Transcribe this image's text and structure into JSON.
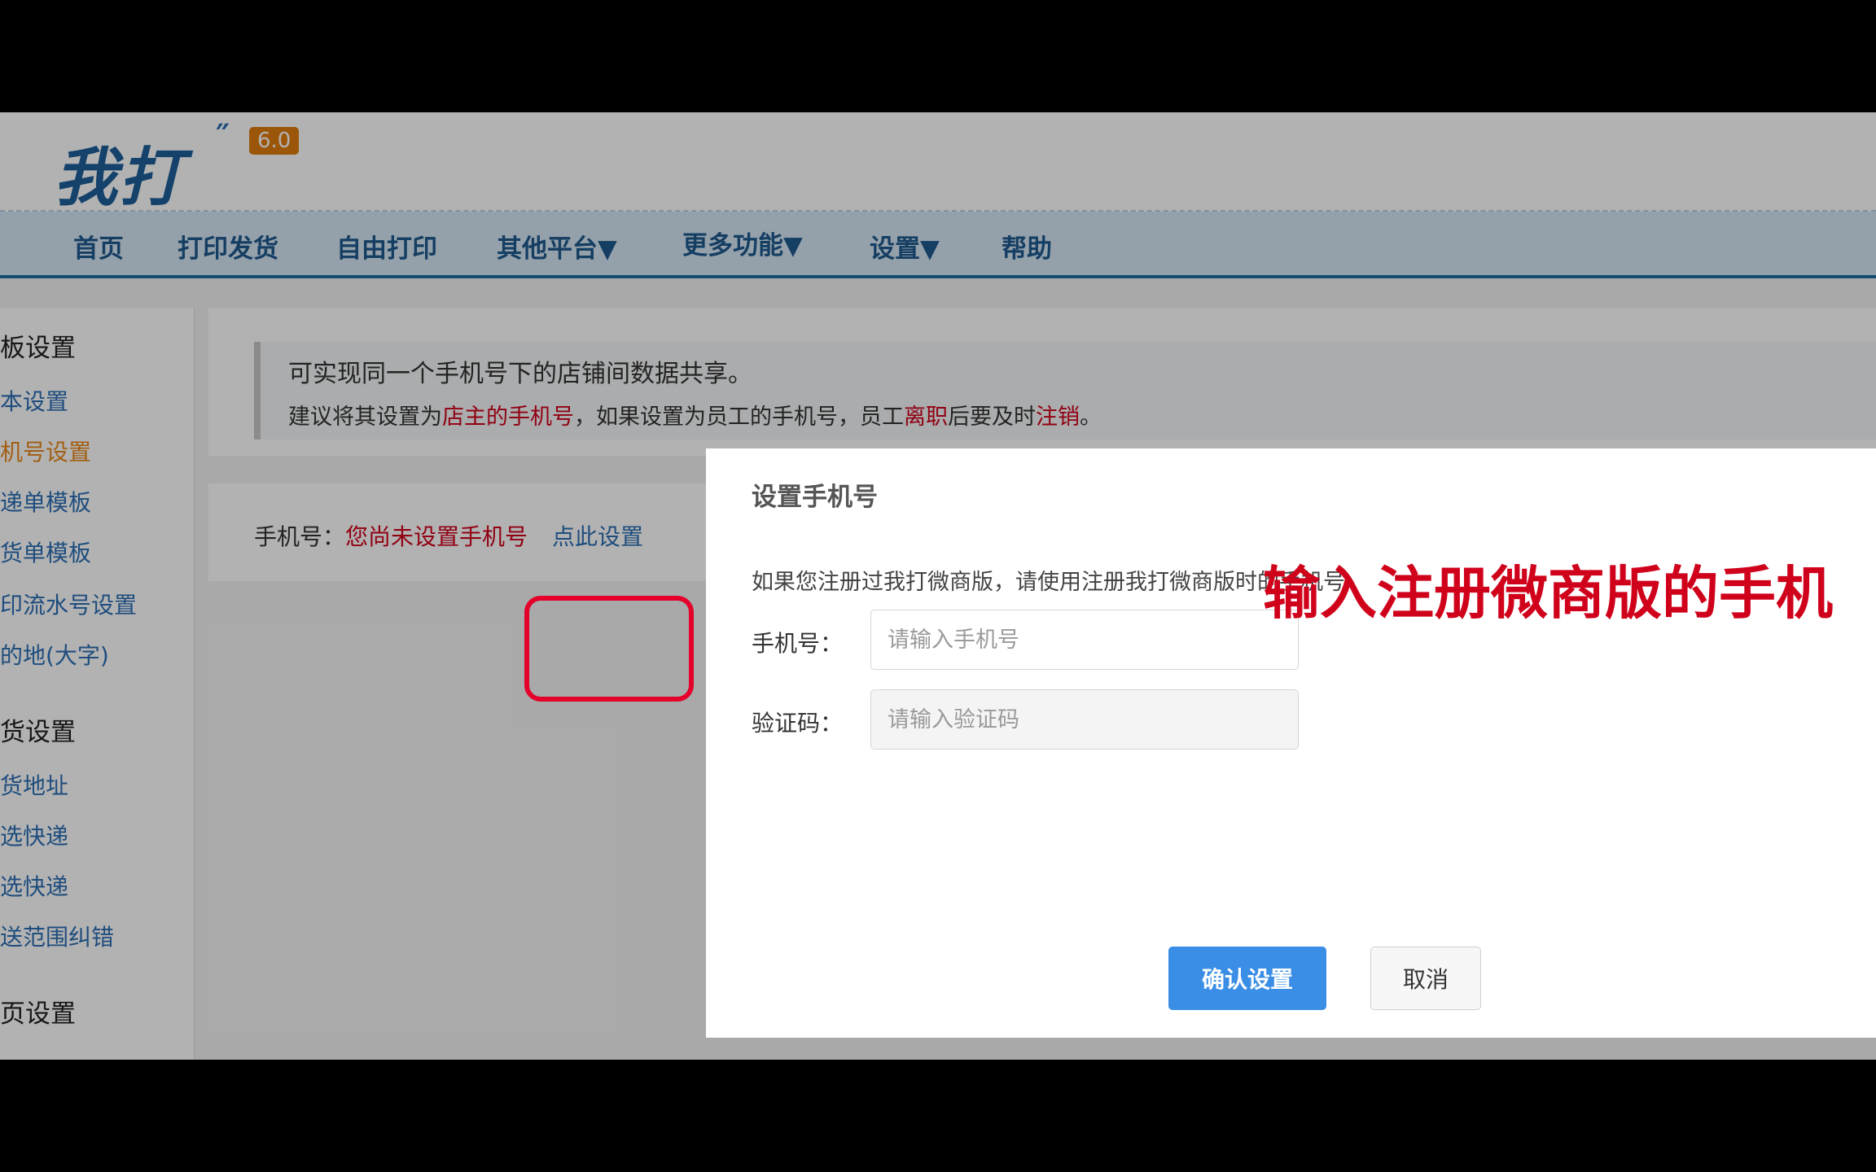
{
  "header": {
    "logo_text": "我打",
    "version": "6.0"
  },
  "nav": {
    "items": [
      {
        "label": "首页"
      },
      {
        "label": "打印发货"
      },
      {
        "label": "自由打印"
      },
      {
        "label": "其他平台▼"
      },
      {
        "label": "更多功能▼"
      },
      {
        "label": "设置▼"
      },
      {
        "label": "帮助"
      }
    ]
  },
  "sidebar": {
    "sections": [
      {
        "title": "板设置",
        "items": [
          "本设置",
          "机号设置",
          "递单模板",
          "货单模板",
          "印流水号设置",
          "的地(大字)"
        ]
      },
      {
        "title": "货设置",
        "items": [
          "货地址",
          "选快递",
          "选快递",
          "送范围纠错"
        ]
      },
      {
        "title": "页设置",
        "items": []
      }
    ],
    "active_item": "机号设置"
  },
  "notice": {
    "line1": "可实现同一个手机号下的店铺间数据共享。",
    "line2_parts": [
      "建议将其设置为",
      "店主的手机号",
      "，如果设置为员工的手机号，员工",
      "离职",
      "后要及时",
      "注销",
      "。"
    ]
  },
  "phone_panel": {
    "label": "手机号：",
    "status": "您尚未设置手机号",
    "set_link": "点此设置"
  },
  "modal": {
    "title": "设置手机号",
    "hint": "如果您注册过我打微商版，请使用注册我打微商版时的手机号",
    "phone_label": "手机号：",
    "phone_placeholder": "请输入手机号",
    "code_label": "验证码：",
    "code_placeholder": "请输入验证码",
    "annotation": "输入注册微商版的手机",
    "confirm_label": "确认设置",
    "cancel_label": "取消"
  },
  "colors": {
    "accent": "#3a8ee6",
    "warning": "#d0021b",
    "link": "#2d6fb5",
    "nav_bg": "#d6e7f4"
  }
}
